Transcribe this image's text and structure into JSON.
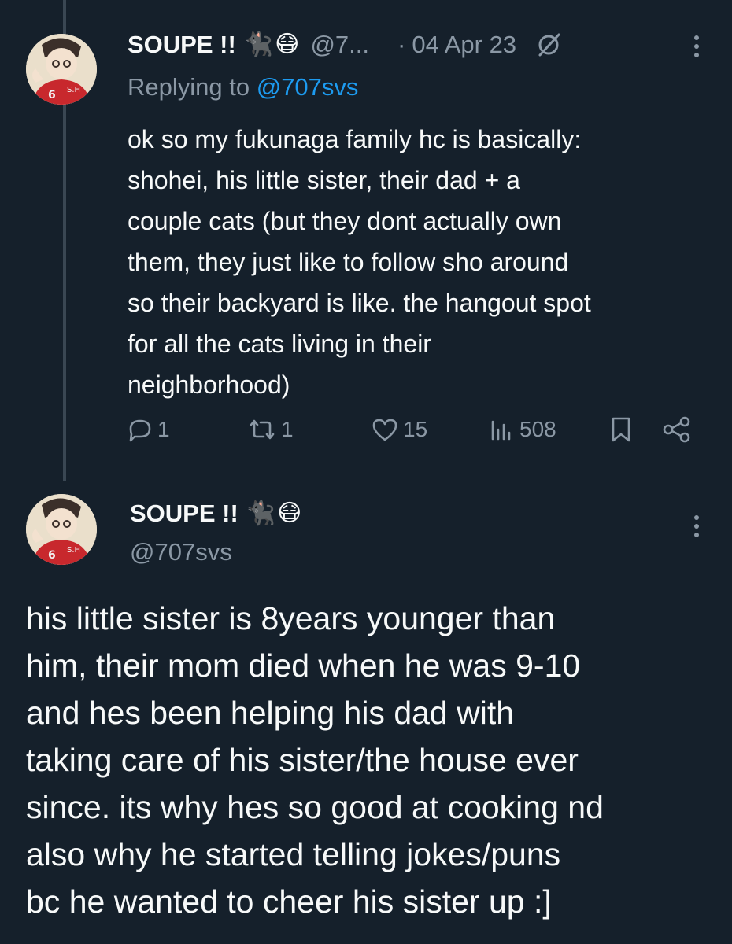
{
  "tweet1": {
    "author_name": "SOUPE !!",
    "handle_truncated": "@7...",
    "separator": "·",
    "date": "04 Apr 23",
    "replying_label": "Replying to",
    "replying_handle": "@707svs",
    "body": "ok so my fukunaga family hc is basically:\nshohei, his little sister, their dad + a\ncouple cats (but they dont actually own\nthem, they just like to follow sho around\nso their backyard is like. the hangout spot\nfor all the cats living in their\nneighborhood)",
    "stats": {
      "replies": "1",
      "reposts": "1",
      "likes": "15",
      "views": "508"
    },
    "icons": {
      "edited": "edit-slash-icon",
      "more": "more-vertical-icon",
      "reply": "reply-icon",
      "repost": "repost-icon",
      "like": "heart-icon",
      "views": "views-icon",
      "bookmark": "bookmark-icon",
      "share": "share-icon"
    }
  },
  "tweet2": {
    "author_name": "SOUPE !!",
    "handle": "@707svs",
    "body": "his little sister is 8years younger than\nhim, their mom died when he was 9-10\nand hes been helping his dad with\ntaking care of his sister/the house ever\nsince. its why hes so good at cooking nd\nalso why he started telling jokes/puns\nbc he wanted to cheer his sister up :]"
  },
  "emoji": {
    "cat": "🐈‍⬛",
    "mask": "😷"
  },
  "colors": {
    "background": "#15202b",
    "text": "#f7f9f9",
    "muted": "#8b98a5",
    "link": "#1d9bf0",
    "thread_line": "#3a4753"
  }
}
